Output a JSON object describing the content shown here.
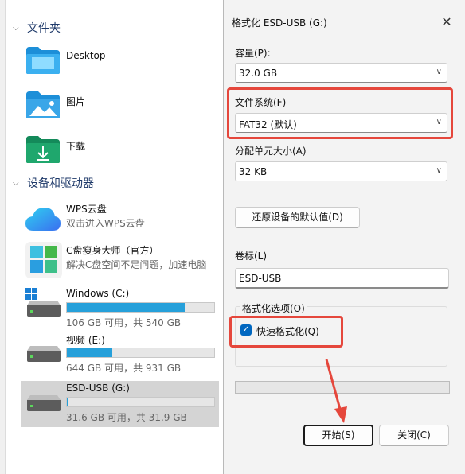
{
  "explorer": {
    "folders_header": "文件夹",
    "folders": [
      {
        "label": "Desktop",
        "icon": "desktop-folder-icon"
      },
      {
        "label": "图片",
        "icon": "pictures-folder-icon"
      },
      {
        "label": "下载",
        "icon": "downloads-folder-icon"
      }
    ],
    "drives_header": "设备和驱动器",
    "apps": [
      {
        "name": "WPS云盘",
        "sub": "双击进入WPS云盘",
        "icon": "wps-cloud-icon"
      },
      {
        "name": "C盘瘦身大师（官方）",
        "sub": "解决C盘空间不足问题，加速电脑",
        "icon": "c-cleaner-icon"
      }
    ],
    "drives": [
      {
        "name": "Windows (C:)",
        "used_fraction": 0.8,
        "free": "106 GB 可用，共 540 GB"
      },
      {
        "name": "视频 (E:)",
        "used_fraction": 0.31,
        "free": "644 GB 可用，共 931 GB"
      },
      {
        "name": "ESD-USB (G:)",
        "used_fraction": 0.01,
        "free": "31.6 GB 可用，共 31.9 GB"
      }
    ]
  },
  "dialog": {
    "title": "格式化 ESD-USB (G:)",
    "close_glyph": "✕",
    "capacity_label": "容量(P):",
    "capacity_value": "32.0 GB",
    "fs_label": "文件系统(F)",
    "fs_value": "FAT32 (默认)",
    "alloc_label": "分配单元大小(A)",
    "alloc_value": "32 KB",
    "restore_button": "还原设备的默认值(D)",
    "volume_label": "卷标(L)",
    "volume_value": "ESD-USB",
    "options_label": "格式化选项(O)",
    "quick_format_label": "快速格式化(Q)",
    "quick_format_checked": true,
    "start_button": "开始(S)",
    "close_button": "关闭(C)",
    "progress": 0
  },
  "annotation": {
    "color": "#e5473c"
  }
}
